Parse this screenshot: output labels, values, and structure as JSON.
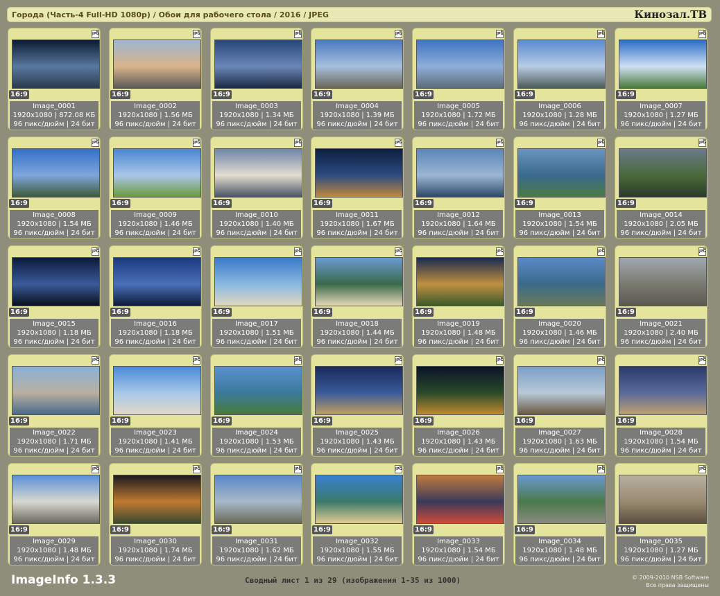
{
  "header": {
    "title": "Города (Часть-4 Full-HD 1080p) / Обои для рабочего стола / 2016 / JPEG",
    "brand": "Кинозал.ТВ"
  },
  "common": {
    "badge": "JPG",
    "ratio": "16:9",
    "meta": "96 пикс/дюйм | 24 бит"
  },
  "images": [
    {
      "name": "Image_0001",
      "dims": "1920x1080 | 872.08 КБ",
      "colors": [
        "#0b1c33",
        "#5a78a0",
        "#2b3a4d"
      ]
    },
    {
      "name": "Image_0002",
      "dims": "1920x1080 | 1.56 МБ",
      "colors": [
        "#9fb6d0",
        "#d9b48a",
        "#5c5a58"
      ]
    },
    {
      "name": "Image_0003",
      "dims": "1920x1080 | 1.34 МБ",
      "colors": [
        "#28477a",
        "#6a86b8",
        "#1c2a44"
      ]
    },
    {
      "name": "Image_0004",
      "dims": "1920x1080 | 1.39 МБ",
      "colors": [
        "#4b79c0",
        "#a7c0de",
        "#6b6656"
      ]
    },
    {
      "name": "Image_0005",
      "dims": "1920x1080 | 1.72 МБ",
      "colors": [
        "#3f74c4",
        "#8faed8",
        "#5d6c7a"
      ]
    },
    {
      "name": "Image_0006",
      "dims": "1920x1080 | 1.28 МБ",
      "colors": [
        "#5a8ad0",
        "#b8cce6",
        "#4d5c58"
      ]
    },
    {
      "name": "Image_0007",
      "dims": "1920x1080 | 1.27 МБ",
      "colors": [
        "#2a6ec8",
        "#cfe0f2",
        "#4a7a3a"
      ]
    },
    {
      "name": "Image_0008",
      "dims": "1920x1080 | 1.54 МБ",
      "colors": [
        "#3470c8",
        "#7ea6dc",
        "#3e5a3a"
      ]
    },
    {
      "name": "Image_0009",
      "dims": "1920x1080 | 1.46 МБ",
      "colors": [
        "#4a86d2",
        "#a9c6e8",
        "#6a9a3c"
      ]
    },
    {
      "name": "Image_0010",
      "dims": "1920x1080 | 1.40 МБ",
      "colors": [
        "#6e86a8",
        "#e3ddd0",
        "#4a5566"
      ]
    },
    {
      "name": "Image_0011",
      "dims": "1920x1080 | 1.67 МБ",
      "colors": [
        "#0e1f40",
        "#2c4a80",
        "#c08a3a"
      ]
    },
    {
      "name": "Image_0012",
      "dims": "1920x1080 | 1.64 МБ",
      "colors": [
        "#5a86b8",
        "#9cb6d2",
        "#2c4a68"
      ]
    },
    {
      "name": "Image_0013",
      "dims": "1920x1080 | 1.54 МБ",
      "colors": [
        "#6a94c0",
        "#3a6a8c",
        "#4a7a44"
      ]
    },
    {
      "name": "Image_0014",
      "dims": "1920x1080 | 2.05 МБ",
      "colors": [
        "#6a7a8a",
        "#4a6a3a",
        "#2c3a2a"
      ]
    },
    {
      "name": "Image_0015",
      "dims": "1920x1080 | 1.18 МБ",
      "colors": [
        "#0c1a3c",
        "#3a5a9a",
        "#0a0f1e"
      ]
    },
    {
      "name": "Image_0016",
      "dims": "1920x1080 | 1.18 МБ",
      "colors": [
        "#1c3a80",
        "#4a70b8",
        "#0e1c3a"
      ]
    },
    {
      "name": "Image_0017",
      "dims": "1920x1080 | 1.51 МБ",
      "colors": [
        "#3a7ac8",
        "#8ab8e0",
        "#e0d8c0"
      ]
    },
    {
      "name": "Image_0018",
      "dims": "1920x1080 | 1.44 МБ",
      "colors": [
        "#6a9ad0",
        "#3a6a4a",
        "#e4d8b8"
      ]
    },
    {
      "name": "Image_0019",
      "dims": "1920x1080 | 1.48 МБ",
      "colors": [
        "#1a2a50",
        "#c09040",
        "#3a5a2a"
      ]
    },
    {
      "name": "Image_0020",
      "dims": "1920x1080 | 1.46 МБ",
      "colors": [
        "#5a8ac8",
        "#3a6a8a",
        "#6a7a5a"
      ]
    },
    {
      "name": "Image_0021",
      "dims": "1920x1080 | 2.40 МБ",
      "colors": [
        "#a0a8b0",
        "#7a7a70",
        "#5a5a50"
      ]
    },
    {
      "name": "Image_0022",
      "dims": "1920x1080 | 1.71 МБ",
      "colors": [
        "#8ab0d8",
        "#b8b0a0",
        "#4a6a8a"
      ]
    },
    {
      "name": "Image_0023",
      "dims": "1920x1080 | 1.41 МБ",
      "colors": [
        "#4a8ad8",
        "#a8c8e8",
        "#e0d8c8"
      ]
    },
    {
      "name": "Image_0024",
      "dims": "1920x1080 | 1.53 МБ",
      "colors": [
        "#5a90d0",
        "#3a7a9a",
        "#4a7a3a"
      ]
    },
    {
      "name": "Image_0025",
      "dims": "1920x1080 | 1.43 МБ",
      "colors": [
        "#1a2a5a",
        "#3a5a9a",
        "#c0a060"
      ]
    },
    {
      "name": "Image_0026",
      "dims": "1920x1080 | 1.43 МБ",
      "colors": [
        "#0a1428",
        "#2a4a2a",
        "#c08a30"
      ]
    },
    {
      "name": "Image_0027",
      "dims": "1920x1080 | 1.63 МБ",
      "colors": [
        "#7aa0c8",
        "#b8c8d8",
        "#6a5a40"
      ]
    },
    {
      "name": "Image_0028",
      "dims": "1920x1080 | 1.54 МБ",
      "colors": [
        "#2a3a6a",
        "#5a6a9a",
        "#c0a070"
      ]
    },
    {
      "name": "Image_0029",
      "dims": "1920x1080 | 1.48 МБ",
      "colors": [
        "#5a90d8",
        "#d8d8d0",
        "#6a6a60"
      ]
    },
    {
      "name": "Image_0030",
      "dims": "1920x1080 | 1.74 МБ",
      "colors": [
        "#1a1a20",
        "#c07a30",
        "#3a4a30"
      ]
    },
    {
      "name": "Image_0031",
      "dims": "1920x1080 | 1.62 МБ",
      "colors": [
        "#5a88c8",
        "#a8b8c8",
        "#6a6a5a"
      ]
    },
    {
      "name": "Image_0032",
      "dims": "1920x1080 | 1.55 МБ",
      "colors": [
        "#3a80d0",
        "#3a7a6a",
        "#e0cc90"
      ]
    },
    {
      "name": "Image_0033",
      "dims": "1920x1080 | 1.54 МБ",
      "colors": [
        "#c07a40",
        "#3a3a5a",
        "#d04a3a"
      ]
    },
    {
      "name": "Image_0034",
      "dims": "1920x1080 | 1.48 МБ",
      "colors": [
        "#6a98d0",
        "#4a7a4a",
        "#8a8a80"
      ]
    },
    {
      "name": "Image_0035",
      "dims": "1920x1080 | 1.27 МБ",
      "colors": [
        "#b8b0a0",
        "#9a8a70",
        "#5a5040"
      ]
    }
  ],
  "footer": {
    "app": "ImageInfo 1.3.3",
    "page": "Сводный лист 1 из 29 (изображения 1-35 из 1000)",
    "copyright_line1": "© 2009-2010 NSB Software",
    "copyright_line2": "Все права защищены"
  }
}
